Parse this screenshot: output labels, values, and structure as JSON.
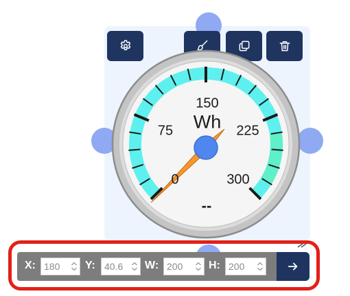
{
  "toolbar_icons": {
    "settings": "gear-icon",
    "style": "paintbrush-icon",
    "duplicate": "copy-icon",
    "delete": "trash-icon"
  },
  "gauge": {
    "unit": "Wh",
    "tick_labels": [
      "0",
      "75",
      "150",
      "225",
      "300"
    ],
    "value_text": "--",
    "min": 0,
    "max": 300,
    "needle_value": 0,
    "arc_color": "#5ef0ee",
    "arc_high_color": "#5ff0c9",
    "needle_color": "#f7972e",
    "hub_color": "#4f86f0"
  },
  "position_bar": {
    "x_label": "X:",
    "x_value": "180",
    "y_label": "Y:",
    "y_value": "40.6",
    "w_label": "W:",
    "w_value": "200",
    "h_label": "H:",
    "h_value": "200",
    "apply_icon": "arrow-right-icon"
  },
  "colors": {
    "toolbar_button": "#1f3560",
    "handle": "#8fa9f2",
    "highlight_frame": "#e32019",
    "bar_background": "#7d7d7d"
  }
}
